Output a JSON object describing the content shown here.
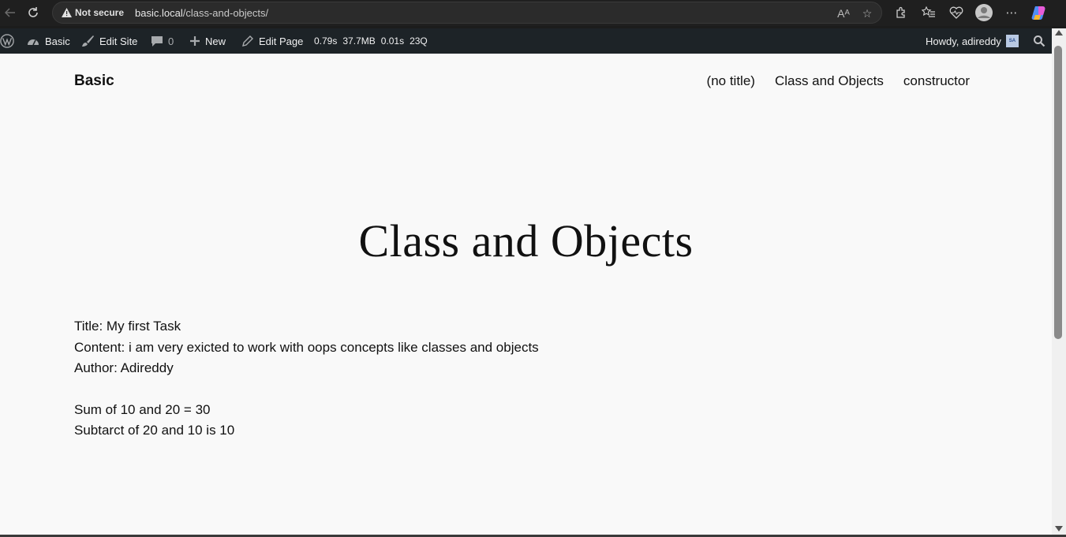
{
  "browser": {
    "security_label": "Not secure",
    "url_host": "basic.local",
    "url_path": "/class-and-objects/"
  },
  "admin_bar": {
    "site_name": "Basic",
    "edit_site": "Edit Site",
    "comments_count": "0",
    "new_label": "New",
    "edit_page": "Edit Page",
    "stats": {
      "time": "0.79s",
      "memory": "37.7MB",
      "query_time": "0.01s",
      "queries": "23Q"
    },
    "greeting": "Howdy, adireddy",
    "avatar_initials": "SA"
  },
  "site": {
    "title": "Basic",
    "nav": [
      "(no title)",
      "Class and Objects",
      "constructor"
    ]
  },
  "page": {
    "title": "Class and Objects",
    "lines": [
      "Title: My first Task",
      "Content: i am very exicted to work with oops concepts like classes and objects",
      "Author: Adireddy",
      "Sum of 10 and 20 = 30",
      "Subtarct of 20 and 10 is 10"
    ]
  }
}
